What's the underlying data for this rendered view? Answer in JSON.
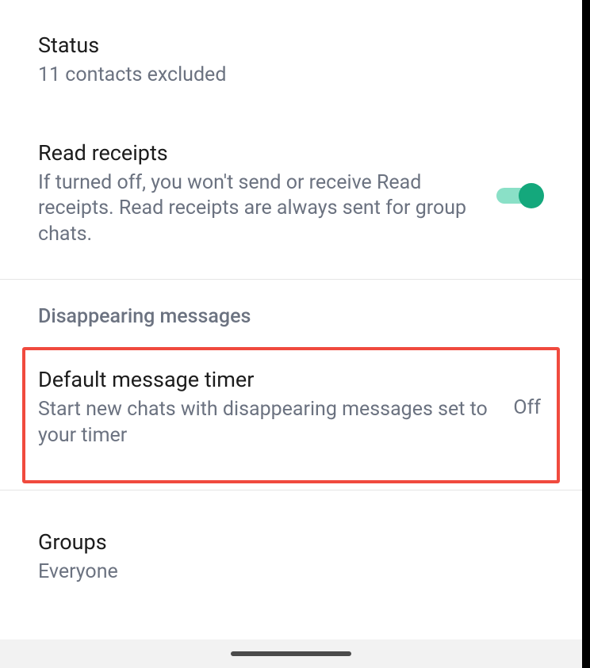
{
  "settings": {
    "status": {
      "title": "Status",
      "subtitle": "11 contacts excluded"
    },
    "read_receipts": {
      "title": "Read receipts",
      "subtitle": "If turned off, you won't send or receive Read receipts. Read receipts are always sent for group chats.",
      "enabled": true
    },
    "disappearing_section": "Disappearing messages",
    "default_timer": {
      "title": "Default message timer",
      "subtitle": "Start new chats with disappearing messages set to your timer",
      "value": "Off"
    },
    "groups": {
      "title": "Groups",
      "subtitle": "Everyone"
    }
  }
}
